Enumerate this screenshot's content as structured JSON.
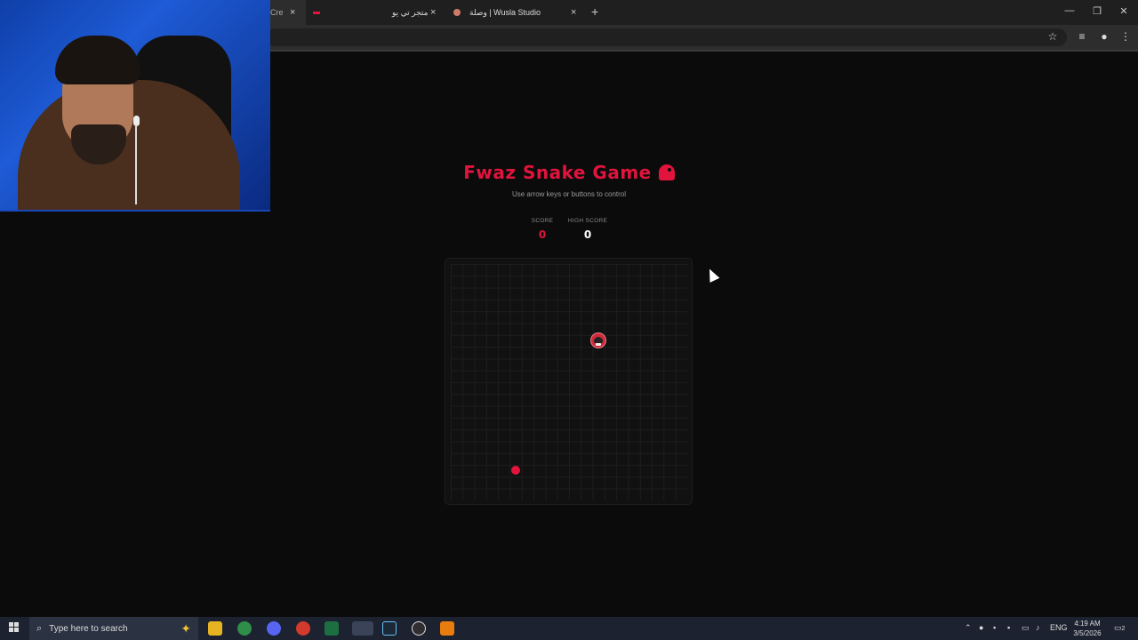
{
  "browser": {
    "tabs": [
      {
        "label": "Cre",
        "active": true
      },
      {
        "label": "",
        "active": false
      },
      {
        "label": "متجر تي يو",
        "active": false
      },
      {
        "label": "وصلة | Wusla Studio",
        "active": false
      }
    ],
    "new_tab_label": "+",
    "close_glyph": "×",
    "window_controls": {
      "minimize": "—",
      "restore": "❐",
      "close": "✕"
    }
  },
  "game": {
    "title": "Fwaz Snake Game",
    "subtitle": "Use arrow keys or buttons to control",
    "score_label": "SCORE",
    "score_value": "0",
    "high_score_label": "HIGH SCORE",
    "high_score_value": "0",
    "colors": {
      "accent": "#e0143c",
      "background": "#0b0b0b",
      "board": "#111111"
    }
  },
  "taskbar": {
    "search_placeholder": "Type here to search",
    "apps": [
      "file-explorer-icon",
      "chrome-icon",
      "discord-icon",
      "app-red-icon",
      "excel-icon",
      "chrome-active-icon",
      "steam-icon",
      "obs-icon",
      "blender-icon"
    ],
    "language": "ENG",
    "time": "4:19 AM",
    "date": "3/5/2026",
    "notifications": "2"
  }
}
